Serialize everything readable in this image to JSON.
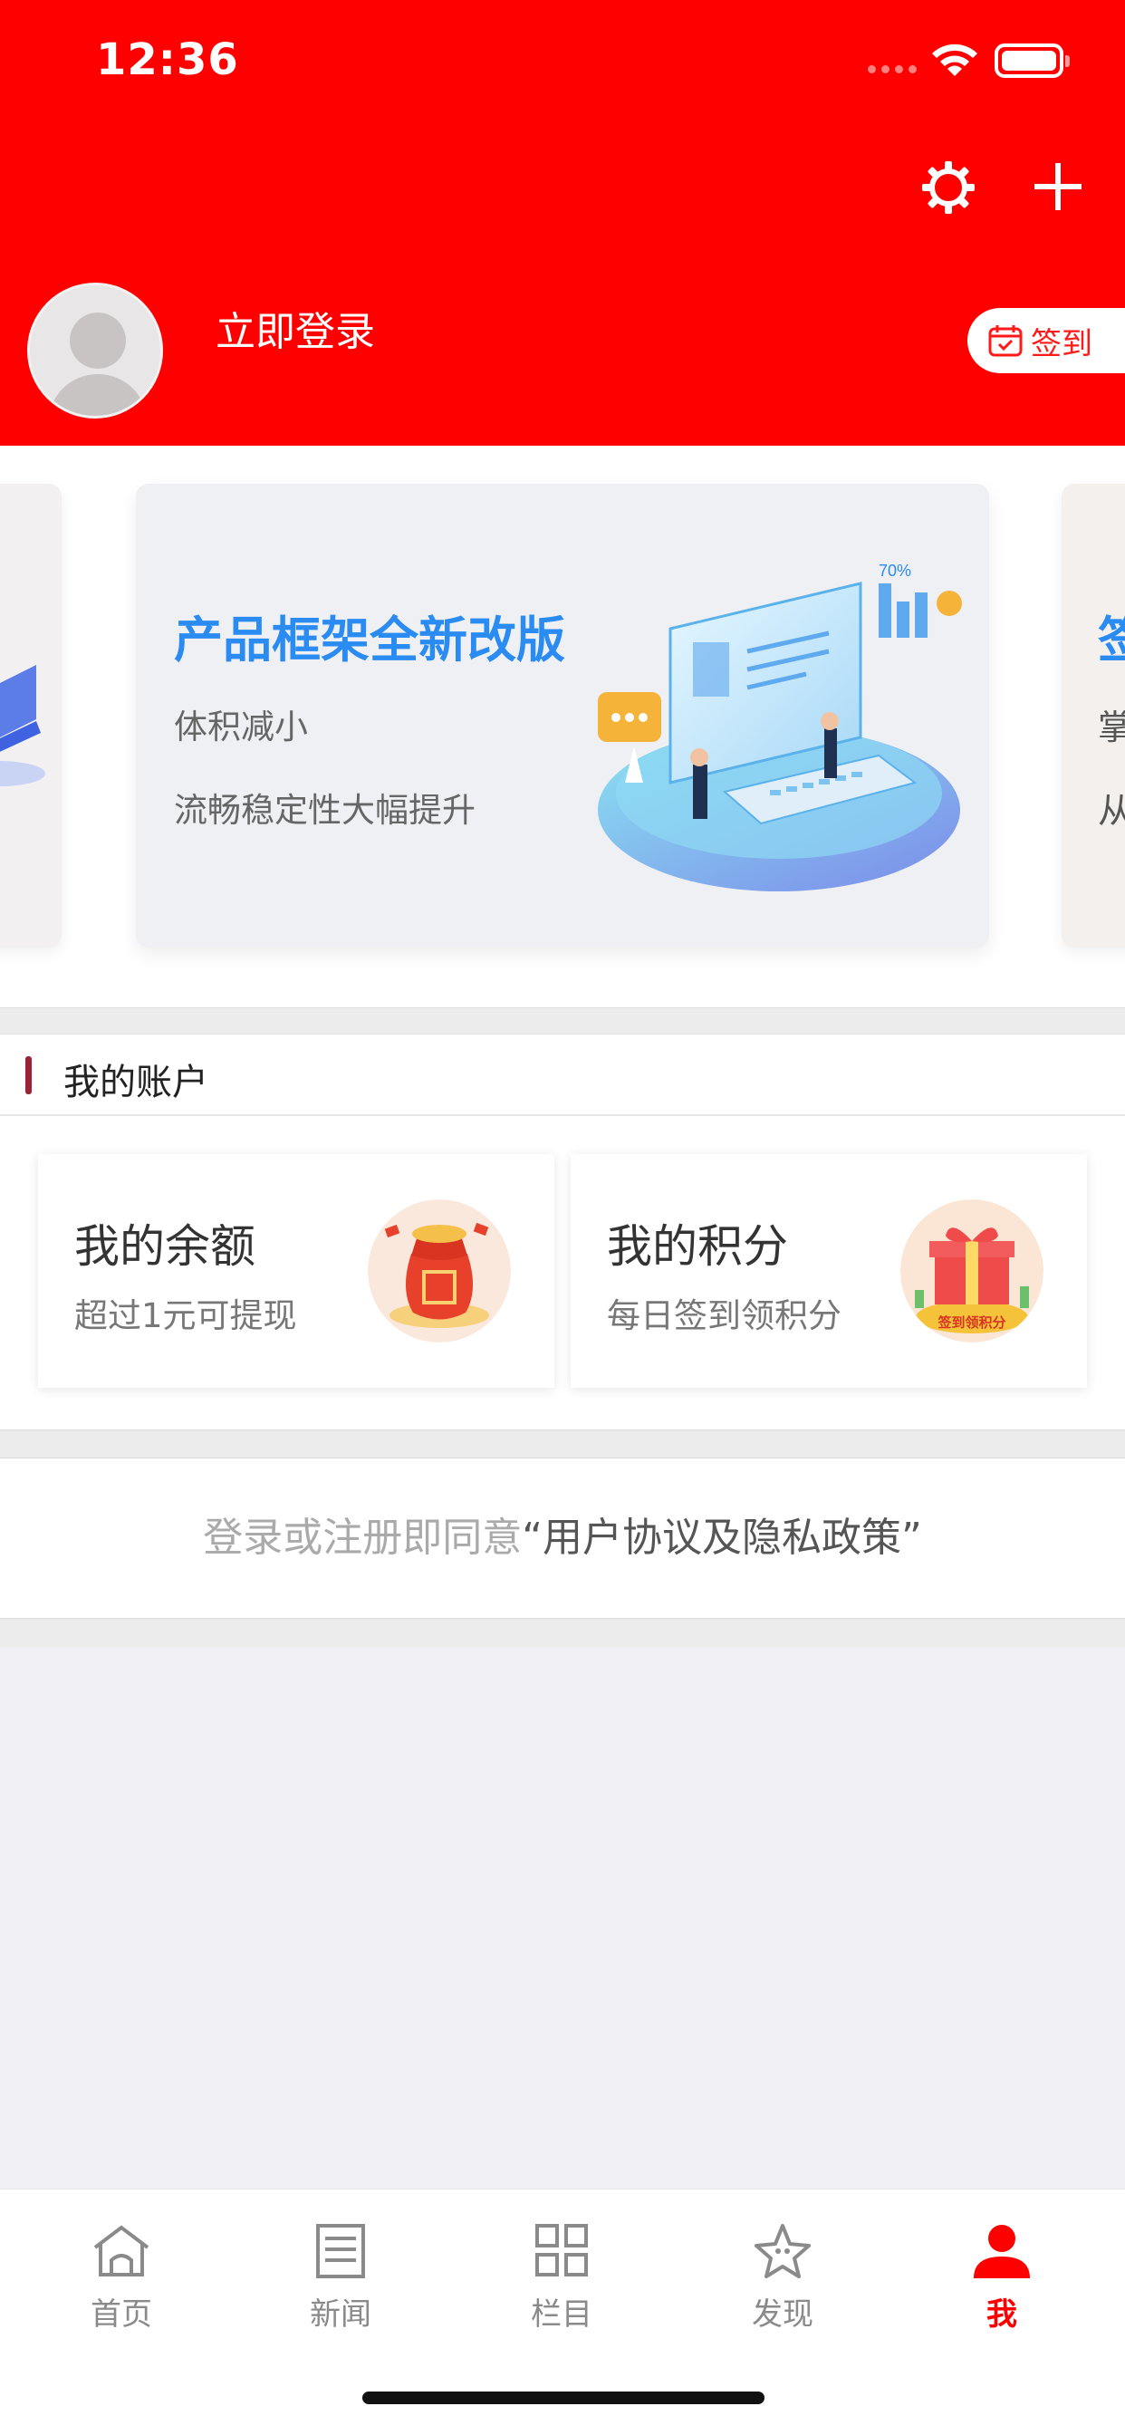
{
  "status_bar": {
    "time": "12:36"
  },
  "header": {
    "settings_icon": "gear-icon",
    "add_icon": "plus-icon",
    "login_text": "立即登录",
    "signin_label": "签到",
    "bg_color": "#ff0000"
  },
  "banner": {
    "title": "产品框架全新改版",
    "line1": "体积减小",
    "line2": "流畅稳定性大幅提升",
    "title_color": "#2a8bf2",
    "next_card_partial": [
      "签",
      "掌",
      "从"
    ]
  },
  "account": {
    "title": "我的账户",
    "balance": {
      "title": "我的余额",
      "subtitle": "超过1元可提现"
    },
    "points": {
      "title": "我的积分",
      "subtitle": "每日签到领积分",
      "badge": "签到领积分"
    }
  },
  "agreement": {
    "prefix": "登录或注册即同意",
    "link": "“用户协议及隐私政策”"
  },
  "tabbar": {
    "items": [
      {
        "label": "首页",
        "icon": "home-icon"
      },
      {
        "label": "新闻",
        "icon": "news-icon"
      },
      {
        "label": "栏目",
        "icon": "grid-icon"
      },
      {
        "label": "发现",
        "icon": "discover-icon"
      },
      {
        "label": "我",
        "icon": "user-icon"
      }
    ],
    "active_index": 4,
    "active_color": "#ff0000"
  }
}
